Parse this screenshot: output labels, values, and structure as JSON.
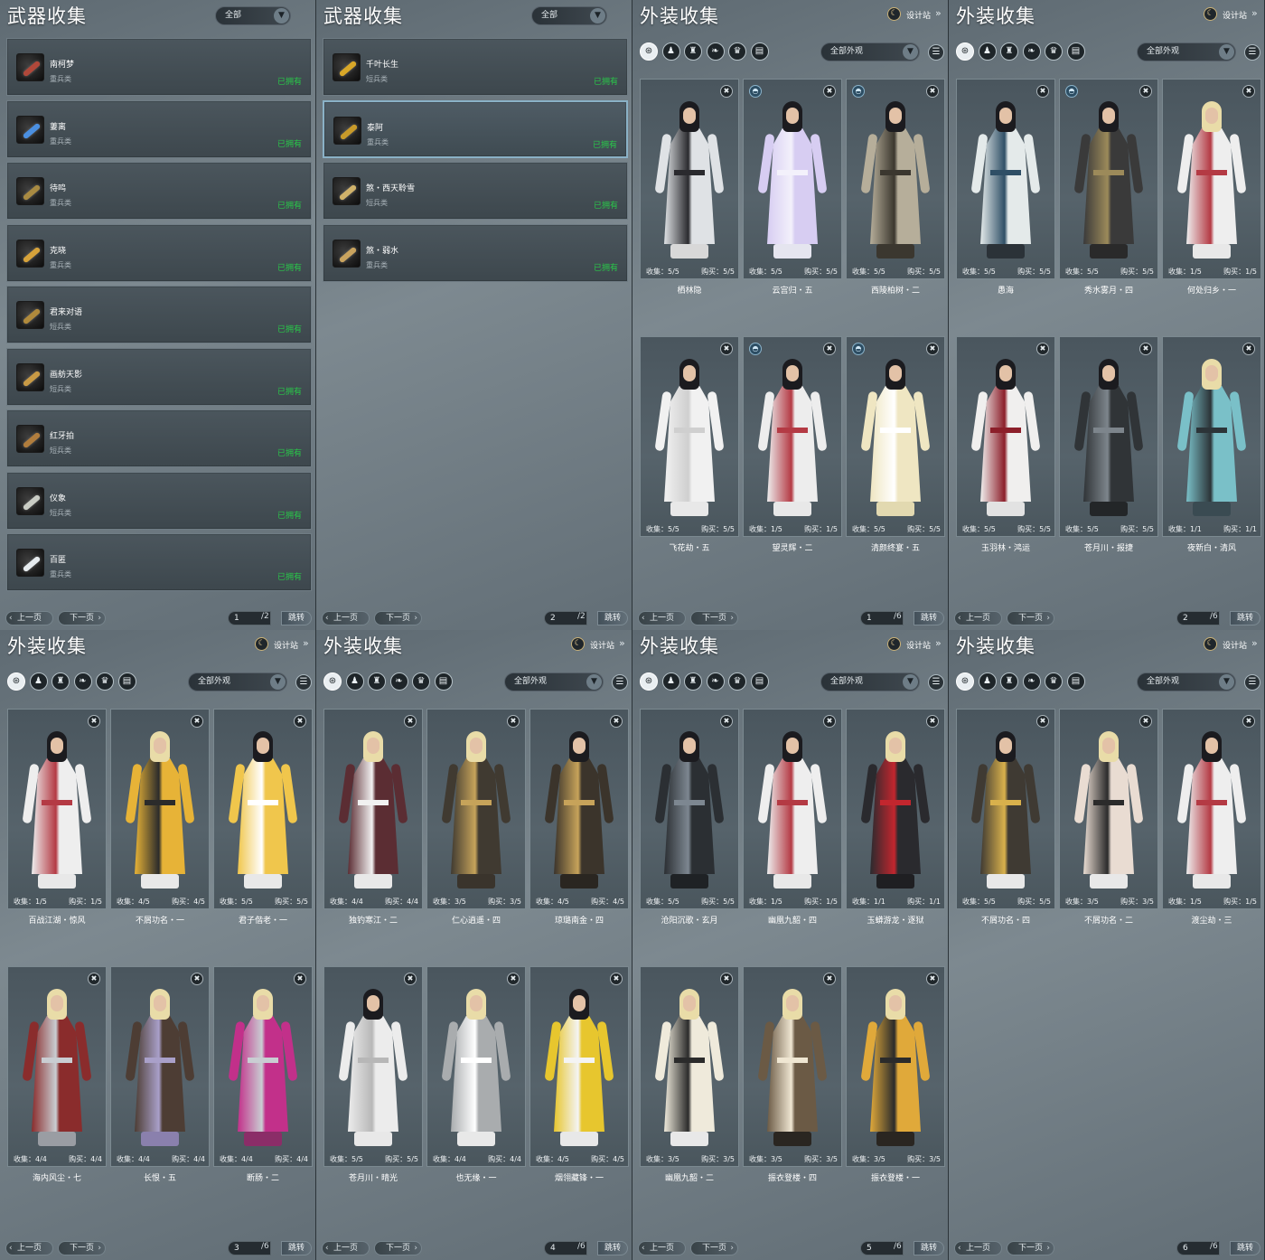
{
  "labels": {
    "weapon_title": "武器收集",
    "outfit_title": "外装收集",
    "filter_all": "全部",
    "filter_all_outfits": "全部外观",
    "design_station": "设计站",
    "prev_page": "上一页",
    "next_page": "下一页",
    "jump": "跳转",
    "collect_label": "收集：",
    "buy_label": "购买：",
    "owned": "已拥有"
  },
  "weapon_pages": [
    {
      "page": "1",
      "total": "/2",
      "items": [
        {
          "name": "南柯梦",
          "type": "重兵类",
          "status": "已拥有",
          "color": "#b0483a"
        },
        {
          "name": "萋离",
          "type": "重兵类",
          "status": "已拥有",
          "color": "#4b8fe0"
        },
        {
          "name": "待鸣",
          "type": "重兵类",
          "status": "已拥有",
          "color": "#a88a42"
        },
        {
          "name": "克晓",
          "type": "重兵类",
          "status": "已拥有",
          "color": "#d6a23a"
        },
        {
          "name": "君来对语",
          "type": "短兵类",
          "status": "已拥有",
          "color": "#b08a3c"
        },
        {
          "name": "画舫天影",
          "type": "短兵类",
          "status": "已拥有",
          "color": "#c89a45"
        },
        {
          "name": "红牙拍",
          "type": "短兵类",
          "status": "已拥有",
          "color": "#b17d3d"
        },
        {
          "name": "仪象",
          "type": "短兵类",
          "status": "已拥有",
          "color": "#c9ccc4"
        },
        {
          "name": "百匿",
          "type": "重兵类",
          "status": "已拥有",
          "color": "#e6ebee"
        }
      ]
    },
    {
      "page": "2",
      "total": "/2",
      "items": [
        {
          "name": "千叶长生",
          "type": "短兵类",
          "status": "已拥有",
          "color": "#d8a728"
        },
        {
          "name": "泰阿",
          "type": "重兵类",
          "status": "已拥有",
          "color": "#c89a2a"
        },
        {
          "name": "煞・西天聆雪",
          "type": "短兵类",
          "status": "已拥有",
          "color": "#d0b26a"
        },
        {
          "name": "煞・弱水",
          "type": "重兵类",
          "status": "已拥有",
          "color": "#c9a35e"
        }
      ]
    }
  ],
  "outfit_pages": [
    {
      "page": "1",
      "total": "/6",
      "items": [
        {
          "name": "栖林隐",
          "collect": "5/5",
          "buy": "5/5",
          "robe": "#dfe2e5",
          "trim": "#2a2a2e",
          "hair": "#1b1b1f",
          "shoes": "#d8d8d8",
          "teacher": false
        },
        {
          "name": "云宫归・五",
          "collect": "5/5",
          "buy": "5/5",
          "robe": "#d7cdf2",
          "trim": "#f3f1fb",
          "hair": "#1b1b1f",
          "shoes": "#e5e5ef",
          "teacher": true
        },
        {
          "name": "西陵柏树・二",
          "collect": "5/5",
          "buy": "5/5",
          "robe": "#b6ae9a",
          "trim": "#3b372f",
          "hair": "#1b1b1f",
          "shoes": "#3b372f",
          "teacher": true
        },
        {
          "name": "飞花劫・五",
          "collect": "5/5",
          "buy": "5/5",
          "robe": "#f1f1f1",
          "trim": "#cfcfcf",
          "hair": "#1b1b1f",
          "shoes": "#e8e8e8",
          "teacher": false
        },
        {
          "name": "望灵辉・二",
          "collect": "1/5",
          "buy": "1/5",
          "robe": "#ededed",
          "trim": "#b43a44",
          "hair": "#1b1b1f",
          "shoes": "#e8e8e8",
          "teacher": true
        },
        {
          "name": "清颜终宴・五",
          "collect": "5/5",
          "buy": "5/5",
          "robe": "#efe6c2",
          "trim": "#ffffff",
          "hair": "#1b1b1f",
          "shoes": "#e2d9b0",
          "teacher": true
        }
      ]
    },
    {
      "page": "2",
      "total": "/6",
      "items": [
        {
          "name": "愚海",
          "collect": "5/5",
          "buy": "5/5",
          "robe": "#e4eaea",
          "trim": "#2f4f66",
          "hair": "#1b1b1f",
          "shoes": "#2b3238",
          "teacher": false
        },
        {
          "name": "秀水雾月・四",
          "collect": "5/5",
          "buy": "5/5",
          "robe": "#3a3a3a",
          "trim": "#9c8a5a",
          "hair": "#1b1b1f",
          "shoes": "#2a2a2a",
          "teacher": true
        },
        {
          "name": "何处归乡・一",
          "collect": "1/5",
          "buy": "1/5",
          "robe": "#eeeeee",
          "trim": "#b43a44",
          "hair": "#e9dca8",
          "shoes": "#e8e8e8",
          "teacher": false
        },
        {
          "name": "玉羽林・鸿运",
          "collect": "5/5",
          "buy": "5/5",
          "robe": "#f0efee",
          "trim": "#8c1f2a",
          "hair": "#1b1b1f",
          "shoes": "#e2e2e2",
          "teacher": false
        },
        {
          "name": "苍月川・报捷",
          "collect": "5/5",
          "buy": "5/5",
          "robe": "#303437",
          "trim": "#7d858c",
          "hair": "#1b1b1f",
          "shoes": "#232628",
          "teacher": false
        },
        {
          "name": "夜新白・清风",
          "collect": "1/1",
          "buy": "1/1",
          "robe": "#7ac0c8",
          "trim": "#2c3438",
          "hair": "#e9dca8",
          "shoes": "#3a4b52",
          "teacher": false
        }
      ]
    },
    {
      "page": "3",
      "total": "/6",
      "items": [
        {
          "name": "百战江湖・惊风",
          "collect": "1/5",
          "buy": "1/5",
          "robe": "#eeeeee",
          "trim": "#b43a44",
          "hair": "#1b1b1f",
          "shoes": "#e8e8e8",
          "teacher": false
        },
        {
          "name": "不屑功名・一",
          "collect": "4/5",
          "buy": "4/5",
          "robe": "#e7b337",
          "trim": "#2b2b2b",
          "hair": "#e9dca8",
          "shoes": "#e8e8e8",
          "teacher": false
        },
        {
          "name": "君子偕老・一",
          "collect": "5/5",
          "buy": "5/5",
          "robe": "#f0c64c",
          "trim": "#ffffff",
          "hair": "#1b1b1f",
          "shoes": "#e8e8e8",
          "teacher": false
        },
        {
          "name": "海内风尘・七",
          "collect": "4/4",
          "buy": "4/4",
          "robe": "#8a2c2c",
          "trim": "#c9cdd2",
          "hair": "#e9dca8",
          "shoes": "#9a9da3",
          "teacher": false
        },
        {
          "name": "长恨・五",
          "collect": "4/4",
          "buy": "4/4",
          "robe": "#4d3d34",
          "trim": "#a9a0c9",
          "hair": "#e9dca8",
          "shoes": "#8a80ad",
          "teacher": false
        },
        {
          "name": "断肠・二",
          "collect": "4/4",
          "buy": "4/4",
          "robe": "#c2308a",
          "trim": "#c9cdd2",
          "hair": "#e9dca8",
          "shoes": "#8b2d68",
          "teacher": false
        }
      ]
    },
    {
      "page": "4",
      "total": "/6",
      "items": [
        {
          "name": "独钓寒江・二",
          "collect": "4/4",
          "buy": "4/4",
          "robe": "#5b2d33",
          "trim": "#f1f1f1",
          "hair": "#e9dca8",
          "shoes": "#e8e8e8",
          "teacher": false
        },
        {
          "name": "仁心逍遥・四",
          "collect": "3/5",
          "buy": "3/5",
          "robe": "#403a31",
          "trim": "#c6a35a",
          "hair": "#e9dca8",
          "shoes": "#3a342c",
          "teacher": false
        },
        {
          "name": "琼璐南金・四",
          "collect": "4/5",
          "buy": "4/5",
          "robe": "#3b342b",
          "trim": "#c7a35a",
          "hair": "#1b1b1f",
          "shoes": "#2a2621",
          "teacher": false
        },
        {
          "name": "苍月川・晴光",
          "collect": "5/5",
          "buy": "5/5",
          "robe": "#ececec",
          "trim": "#b7b7b7",
          "hair": "#1b1b1f",
          "shoes": "#e8e8e8",
          "teacher": false
        },
        {
          "name": "也无缘・一",
          "collect": "4/4",
          "buy": "4/4",
          "robe": "#a9acae",
          "trim": "#ffffff",
          "hair": "#e9dca8",
          "shoes": "#e8e8e8",
          "teacher": false
        },
        {
          "name": "烟翎藏锋・一",
          "collect": "4/5",
          "buy": "4/5",
          "robe": "#e7c62e",
          "trim": "#f4f4f4",
          "hair": "#1b1b1f",
          "shoes": "#e8e8e8",
          "teacher": false
        }
      ]
    },
    {
      "page": "5",
      "total": "/6",
      "items": [
        {
          "name": "沧阳沉歌・玄月",
          "collect": "5/5",
          "buy": "5/5",
          "robe": "#2b2f33",
          "trim": "#7d8791",
          "hair": "#1b1b1f",
          "shoes": "#1f2225",
          "teacher": false
        },
        {
          "name": "幽凰九韶・四",
          "collect": "1/5",
          "buy": "1/5",
          "robe": "#eeeeee",
          "trim": "#b43a44",
          "hair": "#1b1b1f",
          "shoes": "#e8e8e8",
          "teacher": false
        },
        {
          "name": "玉蟒游龙・逐狱",
          "collect": "1/1",
          "buy": "1/1",
          "robe": "#2a2a2e",
          "trim": "#c2262e",
          "hair": "#e9dca8",
          "shoes": "#1f1f22",
          "teacher": false
        },
        {
          "name": "幽凰九韶・二",
          "collect": "3/5",
          "buy": "3/5",
          "robe": "#efeadb",
          "trim": "#2b2b2b",
          "hair": "#e9dca8",
          "shoes": "#e8e8e8",
          "teacher": false
        },
        {
          "name": "振衣登楼・四",
          "collect": "3/5",
          "buy": "3/5",
          "robe": "#6b5a45",
          "trim": "#efe6d2",
          "hair": "#e9dca8",
          "shoes": "#2a2621",
          "teacher": false
        },
        {
          "name": "振衣登楼・一",
          "collect": "3/5",
          "buy": "3/5",
          "robe": "#e0a93a",
          "trim": "#2b2b2b",
          "hair": "#e9dca8",
          "shoes": "#2a2621",
          "teacher": false
        }
      ]
    },
    {
      "page": "6",
      "total": "/6",
      "items": [
        {
          "name": "不屑功名・四",
          "collect": "5/5",
          "buy": "5/5",
          "robe": "#3f3a33",
          "trim": "#d9b14c",
          "hair": "#1b1b1f",
          "shoes": "#e8e8e8",
          "teacher": false
        },
        {
          "name": "不屑功名・二",
          "collect": "3/5",
          "buy": "3/5",
          "robe": "#e9dcd2",
          "trim": "#2b2b2b",
          "hair": "#e9dca8",
          "shoes": "#e8e8e8",
          "teacher": false
        },
        {
          "name": "渡尘劫・三",
          "collect": "1/5",
          "buy": "1/5",
          "robe": "#eeeeee",
          "trim": "#b43a44",
          "hair": "#1b1b1f",
          "shoes": "#e8e8e8",
          "teacher": false
        }
      ]
    }
  ],
  "category_icons": [
    "all-outfits-icon",
    "top-icon",
    "bottom-icon",
    "accessory-icon",
    "hat-icon",
    "document-icon"
  ],
  "category_glyphs": [
    "⊛",
    "♟",
    "♜",
    "❧",
    "♛",
    "▤"
  ]
}
